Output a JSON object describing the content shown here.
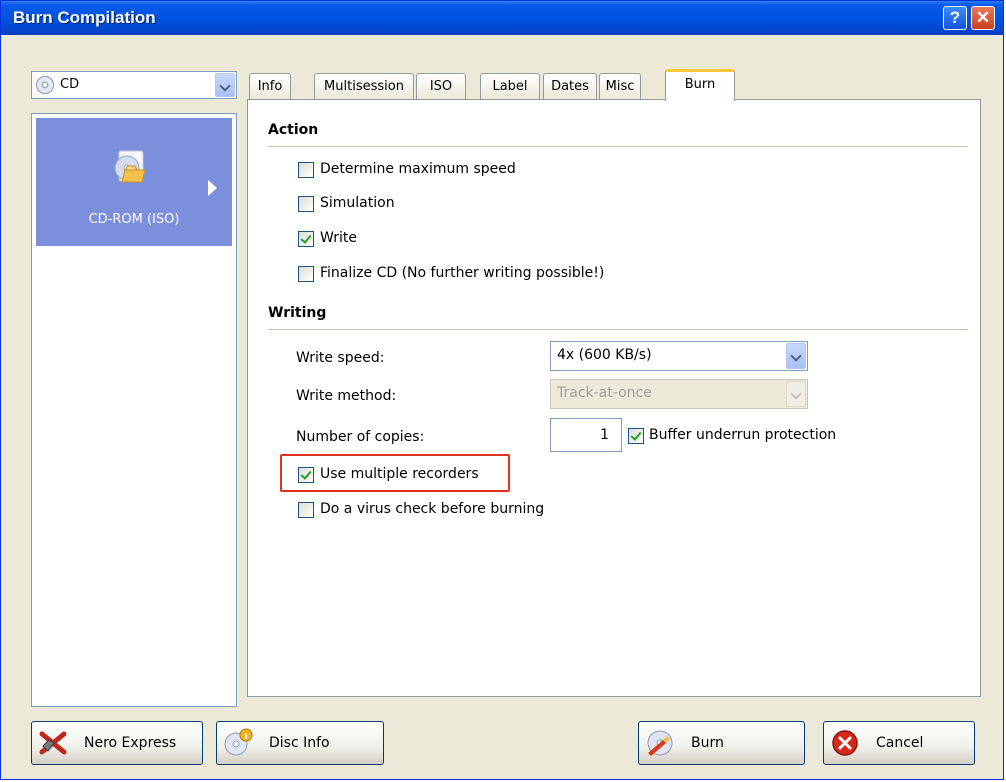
{
  "window": {
    "title": "Burn Compilation",
    "help_glyph": "?",
    "close_glyph": "✕"
  },
  "left": {
    "media_combo_value": "CD",
    "items": [
      {
        "label": "CD-ROM (ISO)",
        "icon": "cd-folder-icon"
      }
    ]
  },
  "tabs": [
    "Info",
    "Multisession",
    "ISO",
    "Label",
    "Dates",
    "Misc",
    "Burn"
  ],
  "active_tab": "Burn",
  "action": {
    "title": "Action",
    "options": [
      {
        "label": "Determine maximum speed",
        "checked": false
      },
      {
        "label": "Simulation",
        "checked": false
      },
      {
        "label": "Write",
        "checked": true
      },
      {
        "label": "Finalize CD (No further writing possible!)",
        "checked": false
      }
    ]
  },
  "writing": {
    "title": "Writing",
    "write_speed_label": "Write speed:",
    "write_speed_value": "4x (600 KB/s)",
    "write_method_label": "Write method:",
    "write_method_value": "Track-at-once",
    "copies_label": "Number of copies:",
    "copies_value": "1",
    "buffer_underrun_label": "Buffer underrun protection",
    "buffer_underrun_checked": true,
    "multiple_recorders_label": "Use multiple recorders",
    "multiple_recorders_checked": true,
    "virus_check_label": "Do a virus check before burning",
    "virus_check_checked": false
  },
  "buttons": {
    "nero_express": "Nero Express",
    "disc_info": "Disc Info",
    "burn": "Burn",
    "cancel": "Cancel"
  },
  "colors": {
    "titlebar": "#0054e3",
    "selection": "#7b8fdd",
    "highlight_box": "#e0301e",
    "checkmark": "#21a121"
  }
}
